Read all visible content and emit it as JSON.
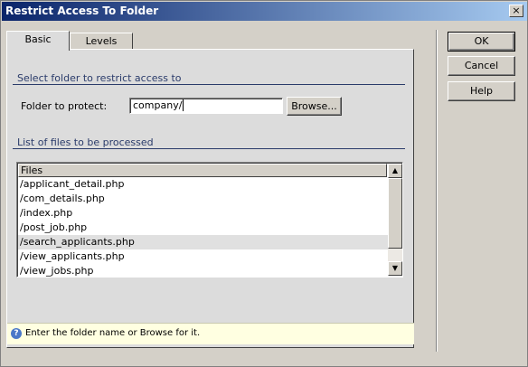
{
  "window": {
    "title": "Restrict Access To Folder",
    "close_glyph": "×"
  },
  "tabs": [
    {
      "label": "Basic"
    },
    {
      "label": "Levels"
    }
  ],
  "section1": {
    "label": "Select folder to restrict access to"
  },
  "folder": {
    "label": "Folder to protect:",
    "value": "company/",
    "browse_label": "Browse..."
  },
  "section2": {
    "label": "List of files to be processed"
  },
  "files": {
    "header": "Files",
    "items": [
      "/applicant_detail.php",
      "/com_details.php",
      "/index.php",
      "/post_job.php",
      "/search_applicants.php",
      "/view_applicants.php",
      "/view_jobs.php"
    ]
  },
  "buttons": {
    "ok": "OK",
    "cancel": "Cancel",
    "help": "Help"
  },
  "hint": {
    "text": "Enter the folder name or Browse for it."
  }
}
